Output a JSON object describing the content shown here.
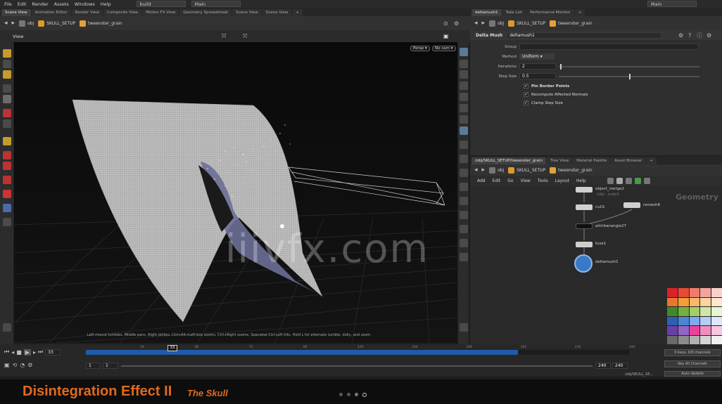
{
  "menubar": {
    "items": [
      "File",
      "Edit",
      "Render",
      "Assets",
      "Windows",
      "Help"
    ],
    "build": "build",
    "desktop": "Main",
    "right_dropdown": "Main"
  },
  "left_pane": {
    "tabs": [
      "Scene View",
      "Animation Editor",
      "Render View",
      "Composite View",
      "Motion FX View",
      "Geometry Spreadsheet",
      "Scene View",
      "Scene View"
    ],
    "path": {
      "context": "obj",
      "node": "SKULL_SETUP",
      "sub": "tweenster_grain"
    },
    "view_title": "View",
    "persp_btn": "Persp ▾",
    "cam_btn": "No cam ▾",
    "status_hint": "Left mouse tumbles. Middle pans. Right dollies. Ctrl+Alt+Left box zooms. Ctrl+Right zooms. Spacebar-Ctrl-Left tilts. Hold L for alternate tumble, dolly, and zoom.",
    "watermark": "iiivfx.com"
  },
  "right_top": {
    "tabs": [
      "deltamush1",
      "Take List",
      "Performance Monitor"
    ],
    "path": {
      "context": "obj",
      "node": "SKULL_SETUP",
      "sub": "tweenster_grain"
    },
    "node_type": "Delta Mush",
    "node_name": "deltamush1",
    "params": [
      {
        "label": "Group",
        "value": ""
      },
      {
        "label": "Method",
        "value": "Uniform ▾"
      },
      {
        "label": "Iterations",
        "value": "2"
      },
      {
        "label": "Step Size",
        "value": "0.5"
      }
    ],
    "iterations_level": 0.01,
    "step_size_level": 0.5,
    "checks": [
      {
        "label": "Pin Border Points",
        "checked": true
      },
      {
        "label": "Recompute Affected Normals",
        "checked": true
      },
      {
        "label": "Clamp Step Size",
        "checked": true
      }
    ]
  },
  "network": {
    "tabs": [
      "/obj/SKULL_SETUP/tweenster_grain",
      "Tree View",
      "Material Palette",
      "Asset Browser"
    ],
    "path": {
      "context": "obj",
      "node": "SKULL_SETUP",
      "sub": "tweenster_grain"
    },
    "menu": [
      "Add",
      "Edit",
      "Go",
      "View",
      "Tools",
      "Layout",
      "Help"
    ],
    "context_label": "Geometry",
    "nodes": [
      {
        "name": "object_merge2",
        "sub": "/obj/...scale1"
      },
      {
        "name": "null1",
        "sub": ""
      },
      {
        "name": "remesh6",
        "sub": ""
      },
      {
        "name": "attribwrangle27",
        "sub": ""
      },
      {
        "name": "fuse1",
        "sub": ""
      },
      {
        "name": "deltamush1",
        "sub": ""
      }
    ]
  },
  "palette": [
    "#d8232a",
    "#e64b35",
    "#f07b6b",
    "#f5a49b",
    "#fbd0cc",
    "#e8772e",
    "#f29d37",
    "#f7b868",
    "#fbd49f",
    "#fde8cc",
    "#3d8a2e",
    "#72b043",
    "#a3cf6a",
    "#cfe6a8",
    "#e9f4d6",
    "#2d5fb5",
    "#4b86d4",
    "#7eaaf0",
    "#b5ccf6",
    "#dde7fb",
    "#6a3fa6",
    "#9464c8",
    "#e8439a",
    "#f08ec0",
    "#f7c6df",
    "#6a6a6a",
    "#8c8c8c",
    "#b0b0b0",
    "#d4d4d4",
    "#f0f0f0"
  ],
  "timeline": {
    "current_frame": "33",
    "frame_field": "33",
    "start": "1",
    "start2": "1",
    "end": "240",
    "end2": "240",
    "ticks": [
      "24",
      "48",
      "72",
      "96",
      "120",
      "144",
      "168",
      "192",
      "216",
      "240"
    ],
    "keys_label": "0 keys, 0/0 channels",
    "keyall_label": "Key All Channels",
    "auto_update": "Auto Update",
    "path_label": "/obj/SKULL_SE..."
  },
  "banner": {
    "title": "Disintegration Effect II",
    "subtitle": "The Skull"
  }
}
